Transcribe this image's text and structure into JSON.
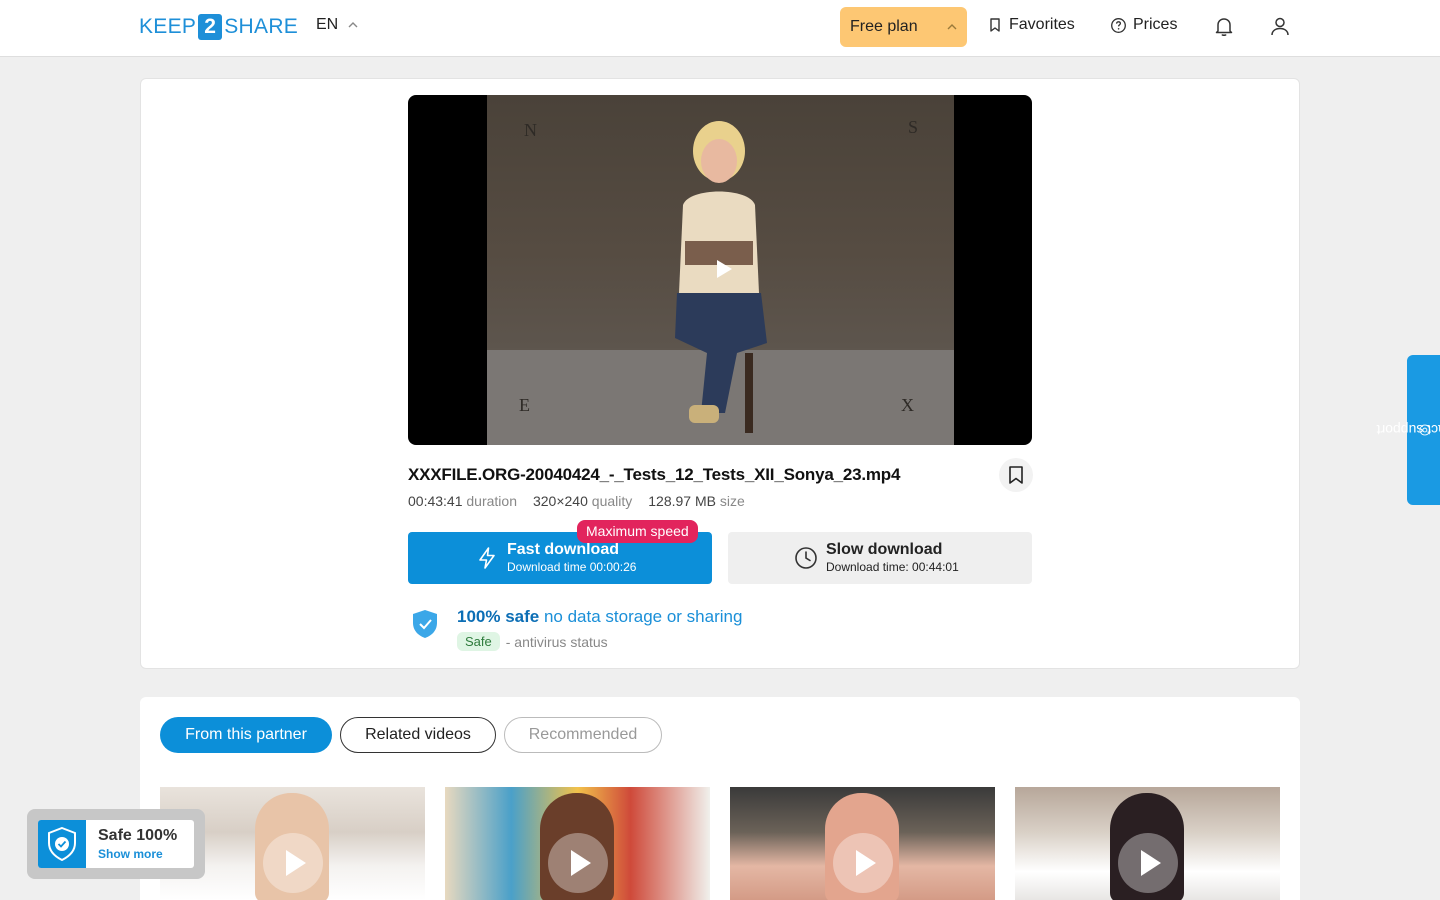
{
  "header": {
    "logo_left": "KEEP",
    "logo_mid": "2",
    "logo_right": "SHARE",
    "language": "EN",
    "plan_label": "Free plan",
    "favorites_label": "Favorites",
    "prices_label": "Prices"
  },
  "video": {
    "corner_tl": "N",
    "corner_tr": "S",
    "corner_bl": "E",
    "corner_br": "X",
    "file_name": "XXXFILE.ORG-20040424_-_Tests_12_Tests_XII_Sonya_23.mp4",
    "duration_value": "00:43:41",
    "duration_label": "duration",
    "quality_value": "320×240",
    "quality_label": "quality",
    "size_value": "128.97 MB",
    "size_label": "size"
  },
  "download": {
    "fast_title": "Fast download",
    "fast_sub": "Download time 00:00:26",
    "max_speed_badge": "Maximum speed",
    "slow_title": "Slow download",
    "slow_sub": "Download time: 00:44:01"
  },
  "safety": {
    "headline_bold": "100% safe",
    "headline_rest": "no data storage or sharing",
    "status_tag": "Safe",
    "status_text": "- antivirus status"
  },
  "tabs": [
    {
      "label": "From this partner"
    },
    {
      "label": "Related videos"
    },
    {
      "label": "Recommended"
    }
  ],
  "safe_widget": {
    "title": "Safe 100%",
    "link": "Show more"
  },
  "support": {
    "label": "contact support"
  },
  "colors": {
    "primary": "#0c8fd9",
    "plan": "#fdc773",
    "badge": "#e2245d"
  },
  "icons": {
    "plan_chevron": "chevron-up-icon",
    "favorites": "bookmark-icon",
    "prices": "question-circle-icon",
    "notifications": "bell-icon",
    "profile": "user-icon",
    "fast": "lightning-icon",
    "slow": "clock-icon",
    "safe": "shield-check-icon"
  }
}
